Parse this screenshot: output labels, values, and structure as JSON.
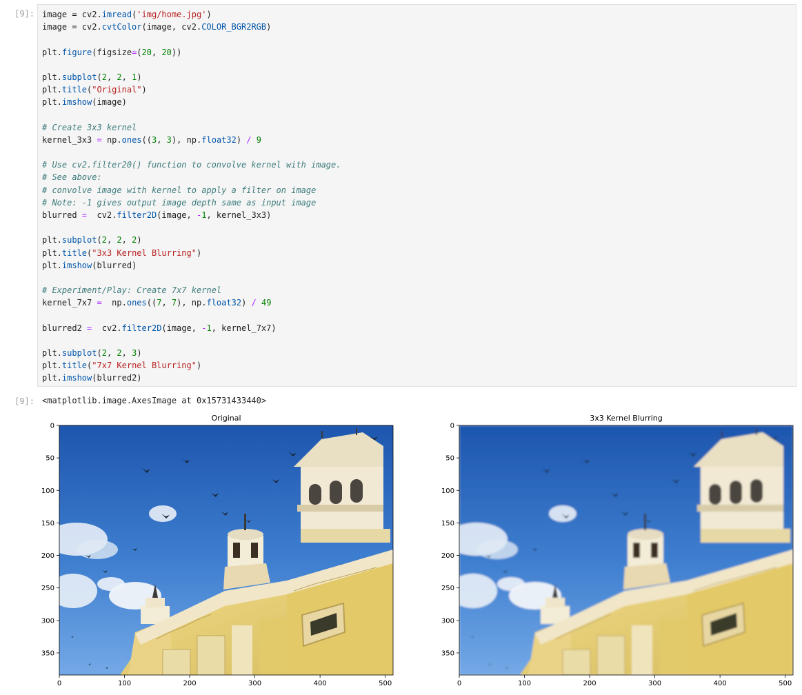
{
  "input_prompt": "[9]:",
  "output_prompt": "[9]:",
  "code_lines": [
    [
      [
        "",
        "image = cv2."
      ],
      [
        "kw-fn",
        "imread"
      ],
      [
        "",
        "("
      ],
      [
        "str",
        "'img/home.jpg'"
      ],
      [
        "",
        ")"
      ]
    ],
    [
      [
        "",
        "image = cv2."
      ],
      [
        "kw-fn",
        "cvtColor"
      ],
      [
        "",
        "(image, cv2."
      ],
      [
        "kw-fn",
        "COLOR_BGR2RGB"
      ],
      [
        "",
        ")"
      ]
    ],
    [],
    [
      [
        "",
        "plt."
      ],
      [
        "kw-fn",
        "figure"
      ],
      [
        "",
        "(figsize"
      ],
      [
        "op",
        "="
      ],
      [
        "",
        "("
      ],
      [
        "num",
        "20"
      ],
      [
        "",
        ", "
      ],
      [
        "num",
        "20"
      ],
      [
        "",
        "))"
      ]
    ],
    [],
    [
      [
        "",
        "plt."
      ],
      [
        "kw-fn",
        "subplot"
      ],
      [
        "",
        "("
      ],
      [
        "num",
        "2"
      ],
      [
        "",
        ", "
      ],
      [
        "num",
        "2"
      ],
      [
        "",
        ", "
      ],
      [
        "num",
        "1"
      ],
      [
        "",
        ")"
      ]
    ],
    [
      [
        "",
        "plt."
      ],
      [
        "kw-fn",
        "title"
      ],
      [
        "",
        "("
      ],
      [
        "str",
        "\"Original\""
      ],
      [
        "",
        ")"
      ]
    ],
    [
      [
        "",
        "plt."
      ],
      [
        "kw-fn",
        "imshow"
      ],
      [
        "",
        "(image)"
      ]
    ],
    [],
    [
      [
        "cm",
        "# Create 3x3 kernel"
      ]
    ],
    [
      [
        "",
        "kernel_3x3 "
      ],
      [
        "op",
        "="
      ],
      [
        "",
        " np."
      ],
      [
        "kw-fn",
        "ones"
      ],
      [
        "",
        "(("
      ],
      [
        "num",
        "3"
      ],
      [
        "",
        ", "
      ],
      [
        "num",
        "3"
      ],
      [
        "",
        "), np."
      ],
      [
        "kw-fn",
        "float32"
      ],
      [
        "",
        ") "
      ],
      [
        "op",
        "/"
      ],
      [
        "",
        ""
      ],
      [
        "num",
        " 9"
      ]
    ],
    [],
    [
      [
        "cm",
        "# Use cv2.filter20() function to convolve kernel with image."
      ]
    ],
    [
      [
        "cm",
        "# See above:"
      ]
    ],
    [
      [
        "cm",
        "# convolve image with kernel to apply a filter on image"
      ]
    ],
    [
      [
        "cm",
        "# Note: -1 gives output image depth same as input image"
      ]
    ],
    [
      [
        "",
        "blurred "
      ],
      [
        "op",
        "="
      ],
      [
        "",
        ""
      ],
      [
        "",
        "  cv2."
      ],
      [
        "kw-fn",
        "filter2D"
      ],
      [
        "",
        "(image, "
      ],
      [
        "op",
        "-"
      ],
      [
        "num",
        "1"
      ],
      [
        "",
        ", kernel_3x3)"
      ]
    ],
    [],
    [
      [
        "",
        "plt."
      ],
      [
        "kw-fn",
        "subplot"
      ],
      [
        "",
        "("
      ],
      [
        "num",
        "2"
      ],
      [
        "",
        ", "
      ],
      [
        "num",
        "2"
      ],
      [
        "",
        ", "
      ],
      [
        "num",
        "2"
      ],
      [
        "",
        ")"
      ]
    ],
    [
      [
        "",
        "plt."
      ],
      [
        "kw-fn",
        "title"
      ],
      [
        "",
        "("
      ],
      [
        "str",
        "\"3x3 Kernel Blurring\""
      ],
      [
        "",
        ")"
      ]
    ],
    [
      [
        "",
        "plt."
      ],
      [
        "kw-fn",
        "imshow"
      ],
      [
        "",
        "(blurred)"
      ]
    ],
    [],
    [
      [
        "cm",
        "# Experiment/Play: Create 7x7 kernel"
      ]
    ],
    [
      [
        "",
        "kernel_7x7 "
      ],
      [
        "op",
        "="
      ],
      [
        "",
        ""
      ],
      [
        "",
        "  np."
      ],
      [
        "kw-fn",
        "ones"
      ],
      [
        "",
        "(("
      ],
      [
        "num",
        "7"
      ],
      [
        "",
        ", "
      ],
      [
        "num",
        "7"
      ],
      [
        "",
        "), np."
      ],
      [
        "kw-fn",
        "float32"
      ],
      [
        "",
        ") "
      ],
      [
        "op",
        "/"
      ],
      [
        "",
        ""
      ],
      [
        "num",
        " 49"
      ]
    ],
    [],
    [
      [
        "",
        "blurred2 "
      ],
      [
        "op",
        "="
      ],
      [
        "",
        ""
      ],
      [
        "",
        "  cv2."
      ],
      [
        "kw-fn",
        "filter2D"
      ],
      [
        "",
        "(image, "
      ],
      [
        "op",
        "-"
      ],
      [
        "num",
        "1"
      ],
      [
        "",
        ", kernel_7x7)"
      ]
    ],
    [],
    [
      [
        "",
        "plt."
      ],
      [
        "kw-fn",
        "subplot"
      ],
      [
        "",
        "("
      ],
      [
        "num",
        "2"
      ],
      [
        "",
        ", "
      ],
      [
        "num",
        "2"
      ],
      [
        "",
        ", "
      ],
      [
        "num",
        "3"
      ],
      [
        "",
        ")"
      ]
    ],
    [
      [
        "",
        "plt."
      ],
      [
        "kw-fn",
        "title"
      ],
      [
        "",
        "("
      ],
      [
        "str",
        "\"7x7 Kernel Blurring\""
      ],
      [
        "",
        ")"
      ]
    ],
    [
      [
        "",
        "plt."
      ],
      [
        "kw-fn",
        "imshow"
      ],
      [
        "",
        "(blurred2)"
      ]
    ]
  ],
  "output_text": "<matplotlib.image.AxesImage at 0x15731433440>",
  "plots": [
    {
      "title": "Original",
      "x_ticks": [
        "0",
        "100",
        "200",
        "300",
        "400",
        "500"
      ],
      "y_ticks": [
        "0",
        "50",
        "100",
        "150",
        "200",
        "250",
        "300",
        "350"
      ],
      "blurred": false
    },
    {
      "title": "3x3 Kernel Blurring",
      "x_ticks": [
        "0",
        "100",
        "200",
        "300",
        "400",
        "500"
      ],
      "y_ticks": [
        "0",
        "50",
        "100",
        "150",
        "200",
        "250",
        "300",
        "350"
      ],
      "blurred": true
    }
  ],
  "colors": {
    "sky_top": "#1d5fb8",
    "sky_bottom": "#5b9be0",
    "building": "#e9d27a",
    "building_shade": "#c8b058",
    "trim": "#f1ead8",
    "cloud": "#f4f7fb"
  }
}
